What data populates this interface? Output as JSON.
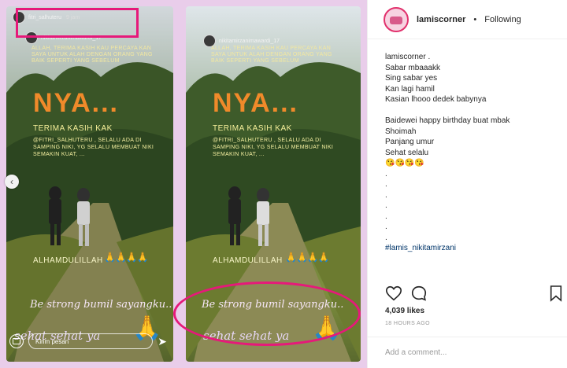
{
  "post": {
    "username": "lamiscorner",
    "separator": "•",
    "follow_status": "Following",
    "caption_lines": [
      "lamiscorner .",
      "Sabar mbaaakk",
      "Sing sabar yes",
      "Kan lagi hamil",
      "Kasian lhooo dedek babynya",
      "",
      "Baidewei happy birthday buat mbak",
      "Shoimah",
      "Panjang umur",
      "Sehat selalu",
      "😘😘😘😘",
      ".",
      ".",
      ".",
      ".",
      ".",
      ".",
      "."
    ],
    "hashtag": "#lamis_nikitamirzani",
    "likes": "4,039 likes",
    "time_ago": "18 HOURS AGO",
    "comment_placeholder": "Add a comment..."
  },
  "stories": {
    "left": {
      "username": "fitri_salhuteru",
      "time": "9 jam",
      "reply_placeholder": "Kirim pesan"
    },
    "right": {
      "username": "nikitamirzanimawardi_17"
    },
    "repost_username": "nikitamirzanimawardi_17",
    "text_top": "ALLAH, TERIMA KASIH KAU PERCAYA KAN SAYA UNTUK ALAH DENGAN ORANG YANG BAIK SEPERTI YANG SEBELUM",
    "text_nya": "NYA...",
    "text_thanks": "Terima Kasih Kak",
    "text_middle": "@fitri_salhuteru , selalu ada di samping niki, yg selalu membuat niki semakin kuat, ...",
    "text_alham": "ALHAMDULILLAH",
    "hands": "🙏🙏🙏🙏",
    "big_hands": "🙏",
    "text_bestrong": "Be strong bumil sayangku..",
    "text_sehat": "sehat sehat ya"
  },
  "colors": {
    "highlight": "#e6197a",
    "frame_bg": "#e9cdea",
    "hashtag": "#003569"
  }
}
